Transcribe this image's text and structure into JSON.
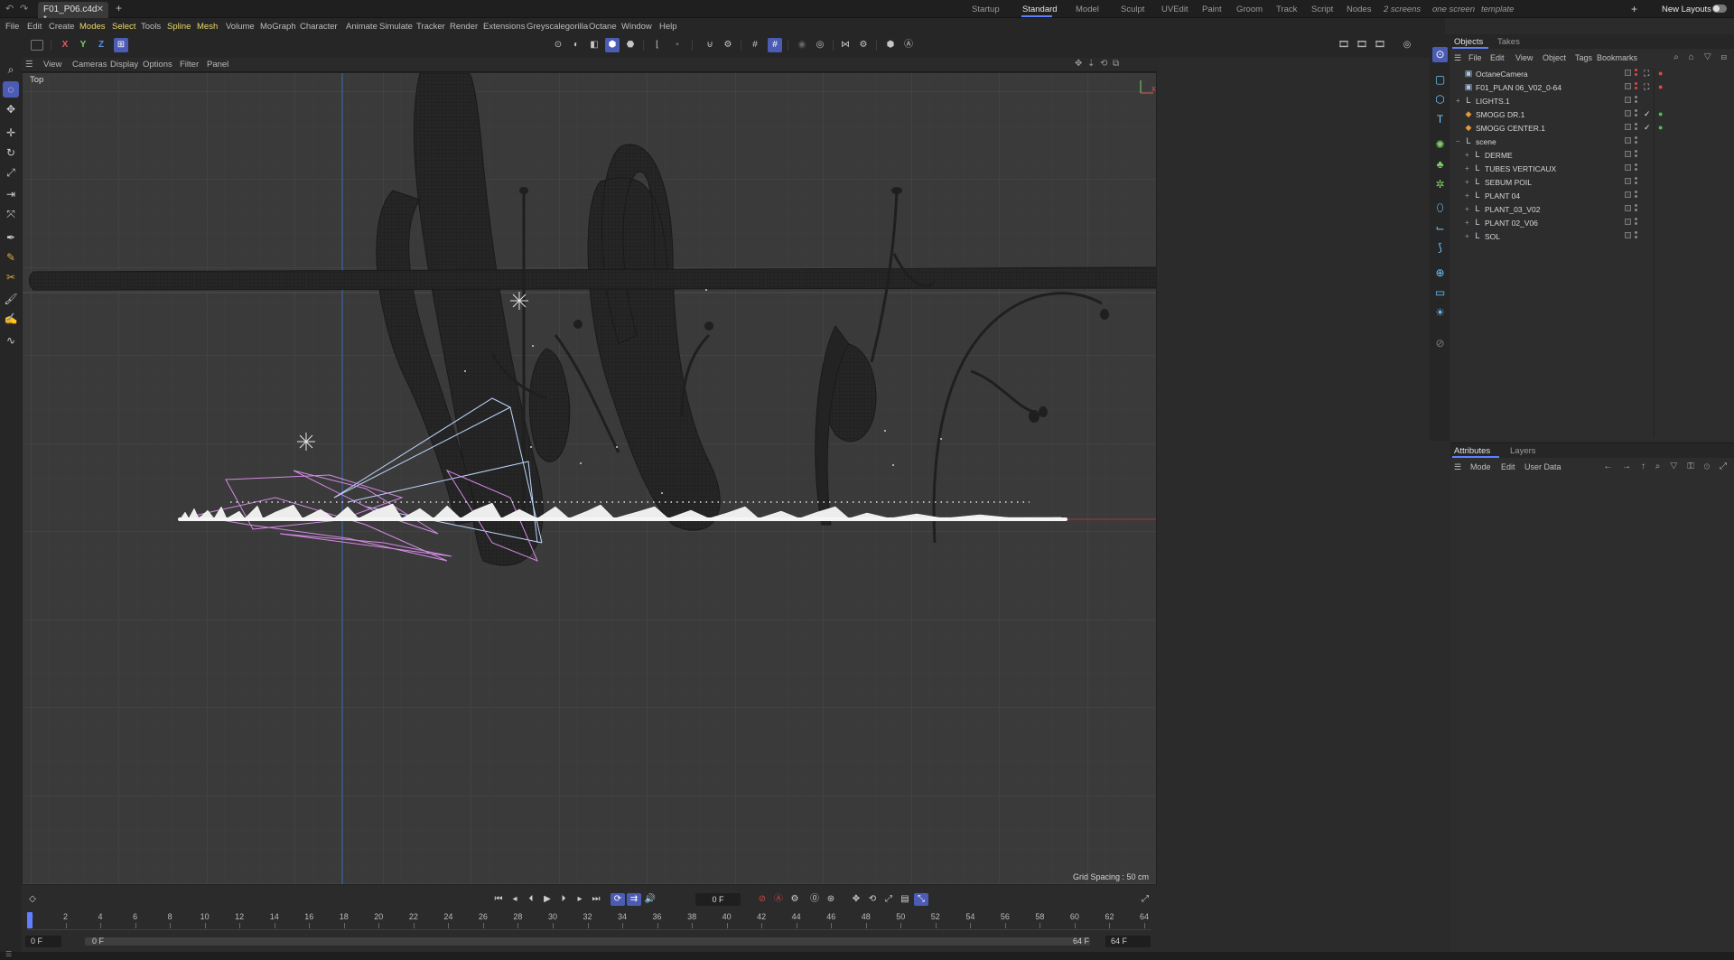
{
  "titlebar": {
    "document_tab": "F01_P06.c4d *",
    "close_glyph": "✕",
    "new_tab_glyph": "+",
    "layouts": [
      "Startup",
      "Standard",
      "Model",
      "Sculpt",
      "UVEdit",
      "Paint",
      "Groom",
      "Track",
      "Script",
      "Nodes",
      "2 screens",
      "one screen",
      "template"
    ],
    "active_layout": "Standard",
    "add_layout_glyph": "+",
    "new_layouts_label": "New Layouts"
  },
  "menubar": {
    "items": [
      "File",
      "Edit",
      "Create",
      "Modes",
      "Select",
      "Tools",
      "Spline",
      "Mesh",
      "Volume",
      "MoGraph",
      "Character",
      "Animate",
      "Simulate",
      "Tracker",
      "Render",
      "Extensions",
      "Greyscalegorilla",
      "Octane",
      "Window",
      "Help"
    ],
    "highlighted": [
      "Modes",
      "Select",
      "Spline",
      "Mesh"
    ]
  },
  "toolbar": {
    "axis_x": "X",
    "axis_y": "Y",
    "axis_z": "Z"
  },
  "viewport": {
    "menu": [
      "View",
      "Cameras",
      "Display",
      "Options",
      "Filter",
      "Panel"
    ],
    "view_name": "Top",
    "grid_spacing": "Grid Spacing : 50 cm",
    "axis_gizmo_y": "Y",
    "axis_gizmo_x": "X"
  },
  "timeline": {
    "current_frame": "0 F",
    "ruler_labels": [
      "0",
      "2",
      "4",
      "6",
      "8",
      "10",
      "12",
      "14",
      "16",
      "18",
      "20",
      "22",
      "24",
      "26",
      "28",
      "30",
      "32",
      "34",
      "36",
      "38",
      "40",
      "42",
      "44",
      "46",
      "48",
      "50",
      "52",
      "54",
      "56",
      "58",
      "60",
      "62",
      "64"
    ],
    "range_start": "0 F",
    "range_start_2": "0 F",
    "range_end": "64 F",
    "range_end_2": "64 F"
  },
  "objects_panel": {
    "tabs": [
      "Objects",
      "Takes"
    ],
    "active_tab": "Objects",
    "menu": [
      "File",
      "Edit",
      "View",
      "Object",
      "Tags",
      "Bookmarks"
    ],
    "rows": [
      {
        "name": "OctaneCamera",
        "indent": 0,
        "expand": "",
        "icon": "camera",
        "tag1": "⛶",
        "tag2": "●",
        "tag2_color": "#e04848"
      },
      {
        "name": "F01_PLAN 06_V02_0-64",
        "indent": 0,
        "expand": "",
        "icon": "camera",
        "tag1": "⛶",
        "tag2": "●",
        "tag2_color": "#e04848"
      },
      {
        "name": "LIGHTS.1",
        "indent": 0,
        "expand": "+",
        "icon": "null",
        "tag1": "",
        "tag2": "",
        "tag2_color": ""
      },
      {
        "name": "SMOGG DR.1",
        "indent": 0,
        "expand": "",
        "icon": "smoke",
        "tag1": "✓",
        "tag2": "●",
        "tag2_color": "#4ec24e"
      },
      {
        "name": "SMOGG CENTER.1",
        "indent": 0,
        "expand": "",
        "icon": "smoke",
        "tag1": "✓",
        "tag2": "●",
        "tag2_color": "#4ec24e"
      },
      {
        "name": "scene",
        "indent": 0,
        "expand": "−",
        "icon": "null",
        "tag1": "",
        "tag2": "",
        "tag2_color": ""
      },
      {
        "name": "DERME",
        "indent": 1,
        "expand": "+",
        "icon": "null",
        "tag1": "",
        "tag2": "",
        "tag2_color": ""
      },
      {
        "name": "TUBES VERTICAUX",
        "indent": 1,
        "expand": "+",
        "icon": "null",
        "tag1": "",
        "tag2": "",
        "tag2_color": ""
      },
      {
        "name": "SEBUM POIL",
        "indent": 1,
        "expand": "+",
        "icon": "null",
        "tag1": "",
        "tag2": "",
        "tag2_color": ""
      },
      {
        "name": "PLANT 04",
        "indent": 1,
        "expand": "+",
        "icon": "null",
        "tag1": "",
        "tag2": "",
        "tag2_color": ""
      },
      {
        "name": "PLANT_03_V02",
        "indent": 1,
        "expand": "+",
        "icon": "null",
        "tag1": "",
        "tag2": "",
        "tag2_color": ""
      },
      {
        "name": "PLANT 02_V06",
        "indent": 1,
        "expand": "+",
        "icon": "null",
        "tag1": "",
        "tag2": "",
        "tag2_color": ""
      },
      {
        "name": "SOL",
        "indent": 1,
        "expand": "+",
        "icon": "null",
        "tag1": "",
        "tag2": "",
        "tag2_color": ""
      }
    ]
  },
  "attributes_panel": {
    "tabs": [
      "Attributes",
      "Layers"
    ],
    "active_tab": "Attributes",
    "menu": [
      "Mode",
      "Edit",
      "User Data"
    ]
  },
  "colors": {
    "accent": "#5f7fff",
    "highlight_menu": "#e9d76a",
    "viewport_bg": "#3a3a3a"
  }
}
